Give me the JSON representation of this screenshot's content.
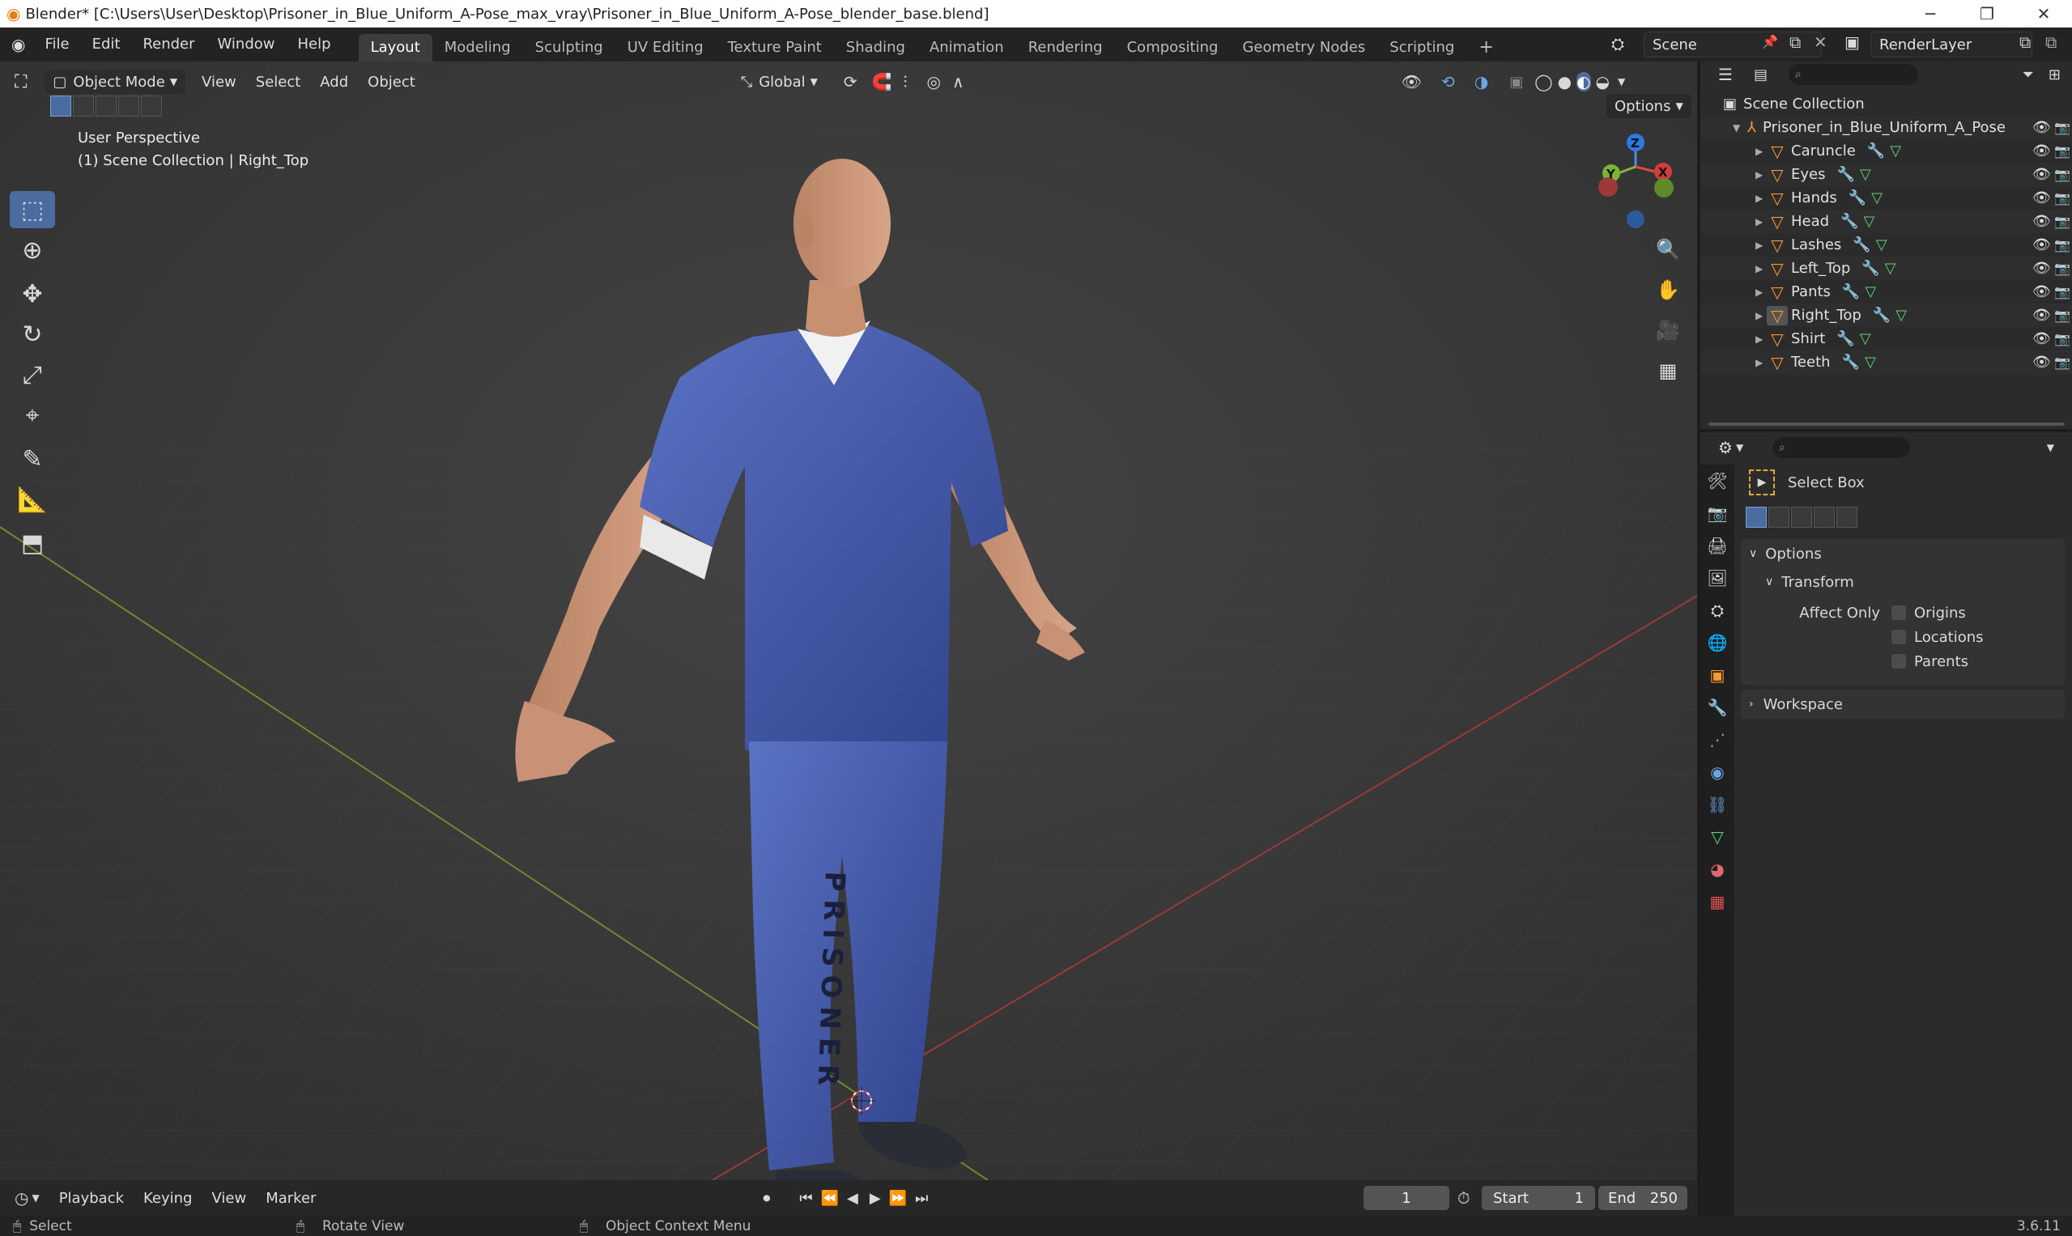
{
  "window": {
    "title": "Blender* [C:\\Users\\User\\Desktop\\Prisoner_in_Blue_Uniform_A-Pose_max_vray\\Prisoner_in_Blue_Uniform_A-Pose_blender_base.blend]"
  },
  "menu": [
    "File",
    "Edit",
    "Render",
    "Window",
    "Help"
  ],
  "workspaces": [
    "Layout",
    "Modeling",
    "Sculpting",
    "UV Editing",
    "Texture Paint",
    "Shading",
    "Animation",
    "Rendering",
    "Compositing",
    "Geometry Nodes",
    "Scripting"
  ],
  "active_workspace": "Layout",
  "scene": {
    "name": "Scene",
    "render_layer": "RenderLayer"
  },
  "viewport": {
    "mode": "Object Mode",
    "menus": [
      "View",
      "Select",
      "Add",
      "Object"
    ],
    "orientation": "Global",
    "options_label": "Options",
    "overlay_line1": "User Perspective",
    "overlay_line2": "(1) Scene Collection | Right_Top",
    "gizmo": {
      "z": "Z",
      "y": "Y",
      "x": "X"
    }
  },
  "outliner": {
    "root": "Scene Collection",
    "collection": "Prisoner_in_Blue_Uniform_A_Pose",
    "objects": [
      "Caruncle",
      "Eyes",
      "Hands",
      "Head",
      "Lashes",
      "Left_Top",
      "Pants",
      "Right_Top",
      "Shirt",
      "Teeth"
    ],
    "active_object": "Right_Top"
  },
  "properties": {
    "tool_name": "Select Box",
    "options_label": "Options",
    "transform_label": "Transform",
    "affect_only_label": "Affect Only",
    "checkboxes": [
      "Origins",
      "Locations",
      "Parents"
    ],
    "workspace_label": "Workspace"
  },
  "timeline": {
    "menus": [
      "Playback",
      "Keying",
      "View",
      "Marker"
    ],
    "current_frame": "1",
    "start_label": "Start",
    "start": "1",
    "end_label": "End",
    "end": "250"
  },
  "statusbar": {
    "select": "Select",
    "rotate": "Rotate View",
    "context": "Object Context Menu",
    "version": "3.6.11"
  },
  "colors": {
    "accent": "#4a6c9e",
    "active_tab": "#3d3d3d",
    "mesh_icon": "#ff9830"
  }
}
